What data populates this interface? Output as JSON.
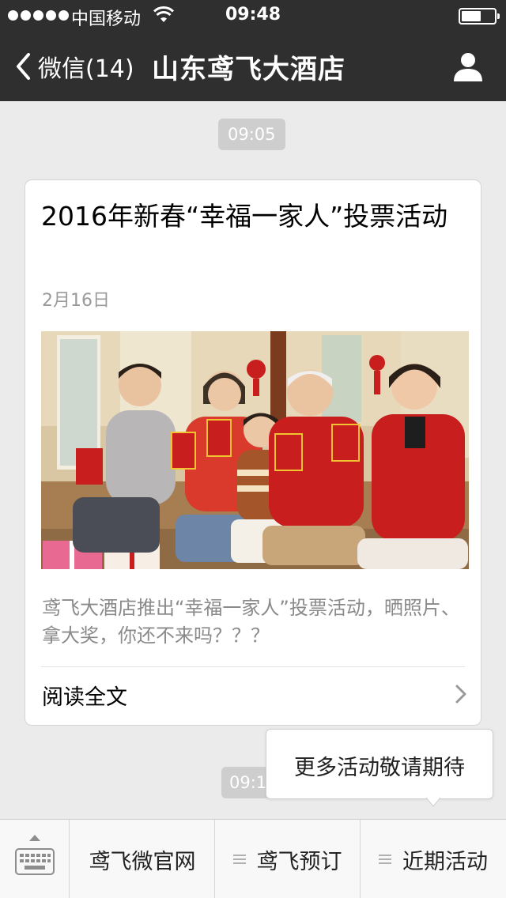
{
  "status_bar": {
    "carrier": "中国移动",
    "time": "09:48"
  },
  "nav": {
    "back_label": "微信(14)",
    "title": "山东鸢飞大酒店"
  },
  "timestamps": [
    "09:05",
    "09:1"
  ],
  "article": {
    "headline": "2016年新春“幸福一家人”投票活动",
    "date": "2月16日",
    "summary": "鸢飞大酒店推出“幸福一家人”投票活动，晒照片、拿大奖，你还不来吗？？？",
    "read_more": "阅读全文"
  },
  "popup": {
    "label": "更多活动敬请期待"
  },
  "menu": {
    "items": [
      {
        "label": "鸢飞微官网"
      },
      {
        "label": "鸢飞预订"
      },
      {
        "label": "近期活动"
      }
    ]
  },
  "colors": {
    "nav_bg": "#2f2f2f",
    "chat_bg": "#ebebeb",
    "pill_bg": "#cecece",
    "festive_red": "#c81e1e"
  },
  "icons": {
    "back": "chevron-left-icon",
    "profile": "person-icon",
    "wifi": "wifi-icon",
    "battery": "battery-icon",
    "keyboard": "keyboard-icon",
    "menu": "hamburger-icon",
    "read_more": "chevron-right-icon"
  }
}
